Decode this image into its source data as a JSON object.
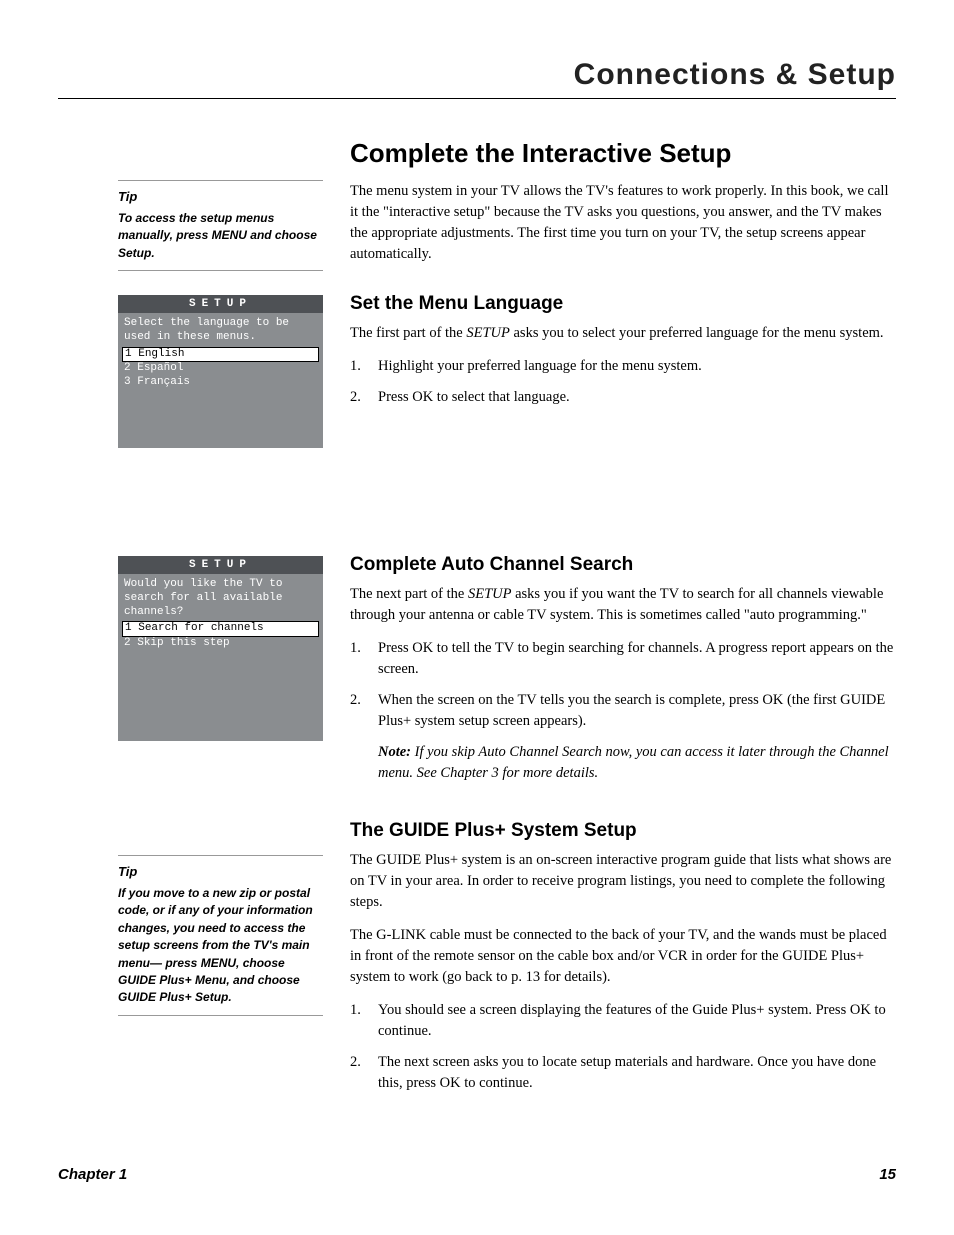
{
  "header": {
    "title": "Connections & Setup"
  },
  "sidebar": {
    "tip1": {
      "title": "Tip",
      "body": "To access the setup menus manually, press MENU and choose Setup."
    },
    "setup1": {
      "title": "SETUP",
      "prompt": "Select the language to be used in these menus.",
      "options": [
        {
          "num": "1",
          "label": "English",
          "selected": true
        },
        {
          "num": "2",
          "label": "Español",
          "selected": false
        },
        {
          "num": "3",
          "label": "Français",
          "selected": false
        }
      ]
    },
    "setup2": {
      "title": "SETUP",
      "prompt": "Would you like the TV to search for all available channels?",
      "options": [
        {
          "num": "1",
          "label": "Search for channels",
          "selected": true
        },
        {
          "num": "2",
          "label": "Skip this step",
          "selected": false
        }
      ]
    },
    "tip2": {
      "title": "Tip",
      "body": "If you move to a new zip or postal code, or if any of your information changes, you need to access the setup screens from the TV's main menu— press MENU, choose GUIDE Plus+ Menu, and choose GUIDE Plus+ Setup."
    }
  },
  "main": {
    "section1": {
      "title": "Complete the Interactive Setup",
      "intro": "The menu system in your TV allows the TV's features to work properly. In this book, we call it the \"interactive setup\" because the TV asks you questions, you answer, and the TV makes the appropriate adjustments. The first time you turn on your TV, the setup screens appear automatically."
    },
    "section2": {
      "title": "Set the Menu Language",
      "intro_a": "The first part of the ",
      "intro_em": "SETUP",
      "intro_b": " asks you to select your preferred language for the menu system.",
      "steps": [
        "Highlight your preferred language for the menu system.",
        "Press OK to select that language."
      ]
    },
    "section3": {
      "title": "Complete Auto Channel Search",
      "intro_a": "The next part of the ",
      "intro_em": "SETUP",
      "intro_b": " asks you if you want the TV to search for all channels viewable through your antenna or cable TV system. This is sometimes called \"auto programming.\"",
      "steps": [
        "Press OK to tell the TV to begin searching for channels. A progress report appears on the screen.",
        "When the screen on the TV tells you the search is complete, press OK (the first GUIDE Plus+ system setup screen appears)."
      ],
      "note_label": "Note:",
      "note_body": "  If you skip Auto Channel Search now, you can access it later through the Channel menu. See Chapter 3 for more details."
    },
    "section4": {
      "title": "The GUIDE Plus+ System Setup",
      "p1": "The GUIDE Plus+ system is an on-screen interactive program guide that lists what shows are on TV in your area. In order to receive program listings, you need to complete the following steps.",
      "p2": "The G-LINK cable must be connected to the back of your TV, and the wands must be placed in front of the remote sensor on the cable box and/or VCR in order for the GUIDE Plus+ system to work (go back to p. 13 for details).",
      "steps": [
        "You should see a screen displaying the features of the Guide Plus+ system. Press OK to continue.",
        "The next screen asks you to locate setup materials and hardware. Once you have done this, press OK to continue."
      ]
    }
  },
  "footer": {
    "chapter": "Chapter 1",
    "page": "15"
  }
}
